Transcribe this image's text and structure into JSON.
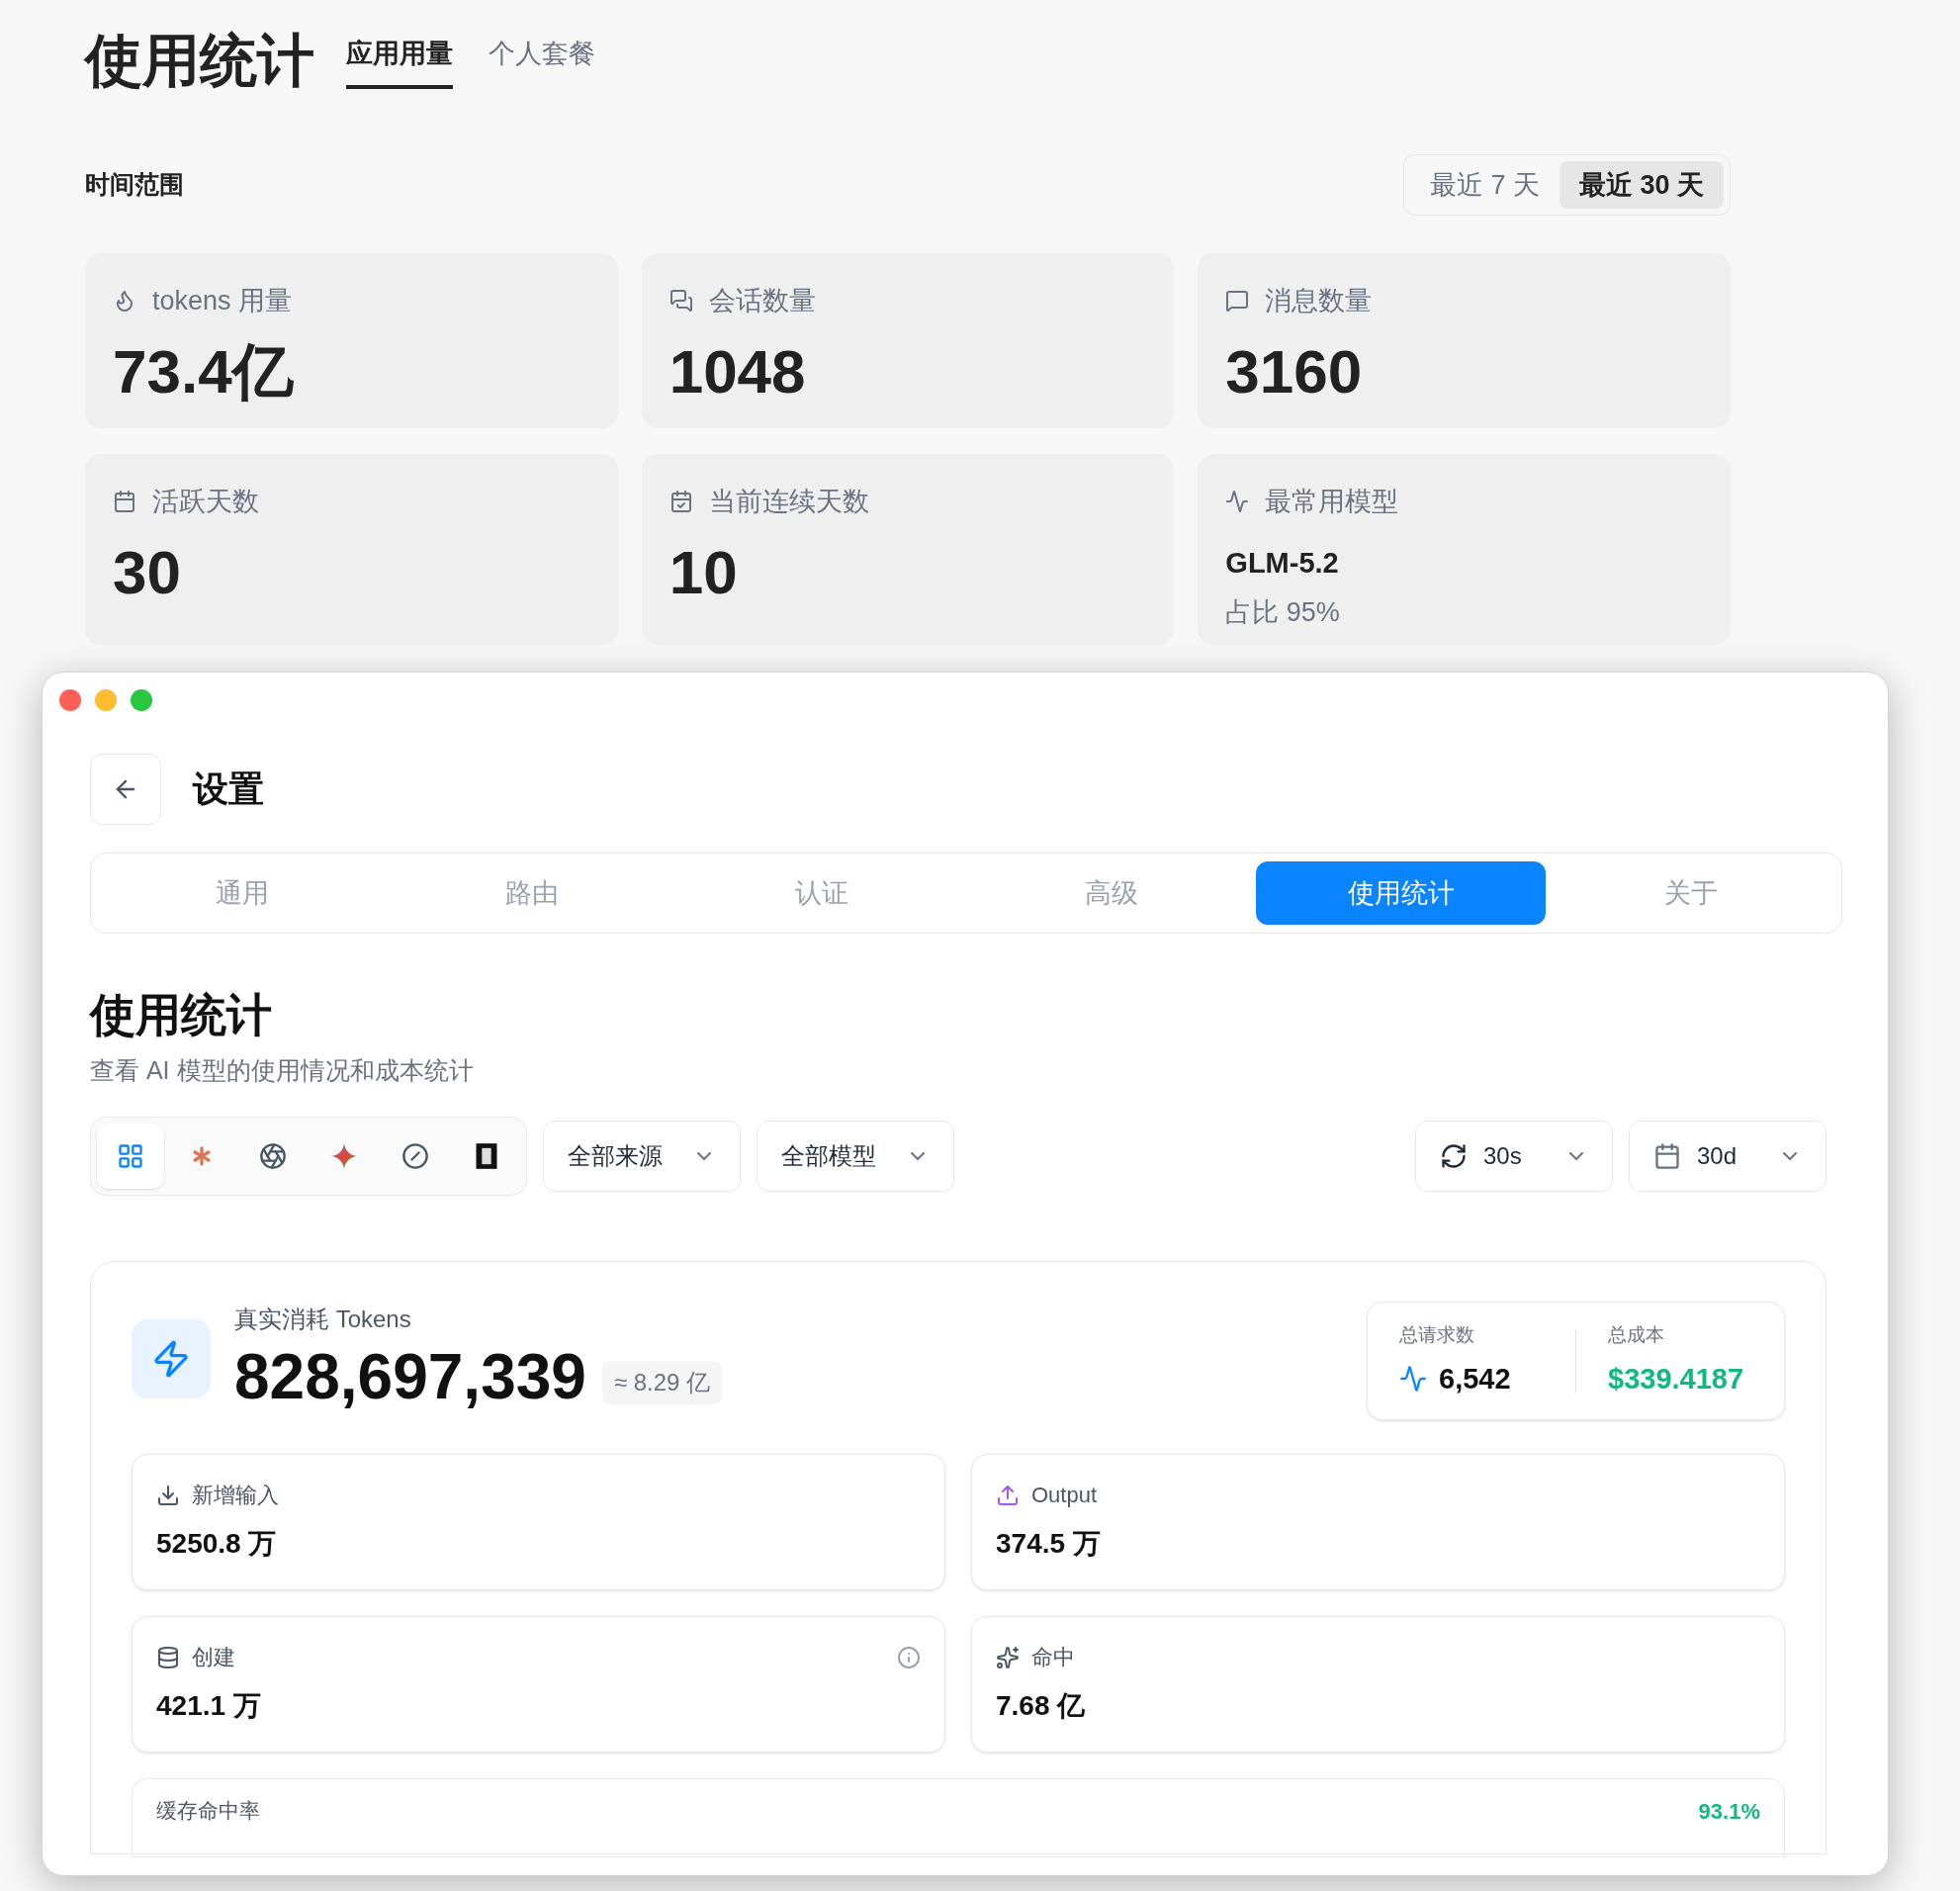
{
  "page": {
    "title": "使用统计",
    "tabs": [
      {
        "label": "应用用量",
        "selected": true
      },
      {
        "label": "个人套餐",
        "selected": false
      }
    ]
  },
  "time_range": {
    "label": "时间范围",
    "options": [
      {
        "label": "最近 7 天",
        "selected": false
      },
      {
        "label": "最近 30 天",
        "selected": true
      }
    ]
  },
  "stat_cards": [
    {
      "kind": "flame",
      "label": "tokens 用量",
      "value": "73.4亿"
    },
    {
      "kind": "chats",
      "label": "会话数量",
      "value": "1048"
    },
    {
      "kind": "message",
      "label": "消息数量",
      "value": "3160"
    },
    {
      "kind": "calendar",
      "label": "活跃天数",
      "value": "30"
    },
    {
      "kind": "calendar-check",
      "label": "当前连续天数",
      "value": "10"
    },
    {
      "kind": "activity",
      "label": "最常用模型",
      "value": "GLM-5.2",
      "note": "占比 95%"
    }
  ],
  "settings_window": {
    "title": "设置",
    "tabs": [
      {
        "label": "通用",
        "selected": false
      },
      {
        "label": "路由",
        "selected": false
      },
      {
        "label": "认证",
        "selected": false
      },
      {
        "label": "高级",
        "selected": false
      },
      {
        "label": "使用统计",
        "selected": true
      },
      {
        "label": "关于",
        "selected": false
      }
    ],
    "heading": "使用统计",
    "subtitle": "查看 AI 模型的使用情况和成本统计",
    "provider_filters": [
      {
        "kind": "grid",
        "selected": true
      },
      {
        "kind": "asterisk",
        "selected": false
      },
      {
        "kind": "knot",
        "selected": false
      },
      {
        "kind": "sparkle",
        "selected": false
      },
      {
        "kind": "circle-slash",
        "selected": false
      },
      {
        "kind": "square",
        "selected": false
      }
    ],
    "source_select": {
      "value": "全部来源"
    },
    "model_select": {
      "value": "全部模型"
    },
    "refresh_select": {
      "value": "30s"
    },
    "range_select": {
      "value": "30d"
    },
    "summary": {
      "label": "真实消耗 Tokens",
      "value": "828,697,339",
      "approx": "≈ 8.29 亿",
      "requests": {
        "label": "总请求数",
        "value": "6,542"
      },
      "cost": {
        "label": "总成本",
        "value": "$339.4187"
      }
    },
    "metrics": [
      {
        "kind": "input",
        "label": "新增输入",
        "value": "5250.8 万",
        "info": false
      },
      {
        "kind": "output",
        "label": "Output",
        "value": "374.5 万",
        "info": false
      },
      {
        "kind": "database",
        "label": "创建",
        "value": "421.1 万",
        "info": true
      },
      {
        "kind": "sparkles",
        "label": "命中",
        "value": "7.68 亿",
        "info": false
      }
    ],
    "hit_rate": {
      "label": "缓存命中率",
      "value": "93.1%"
    }
  }
}
